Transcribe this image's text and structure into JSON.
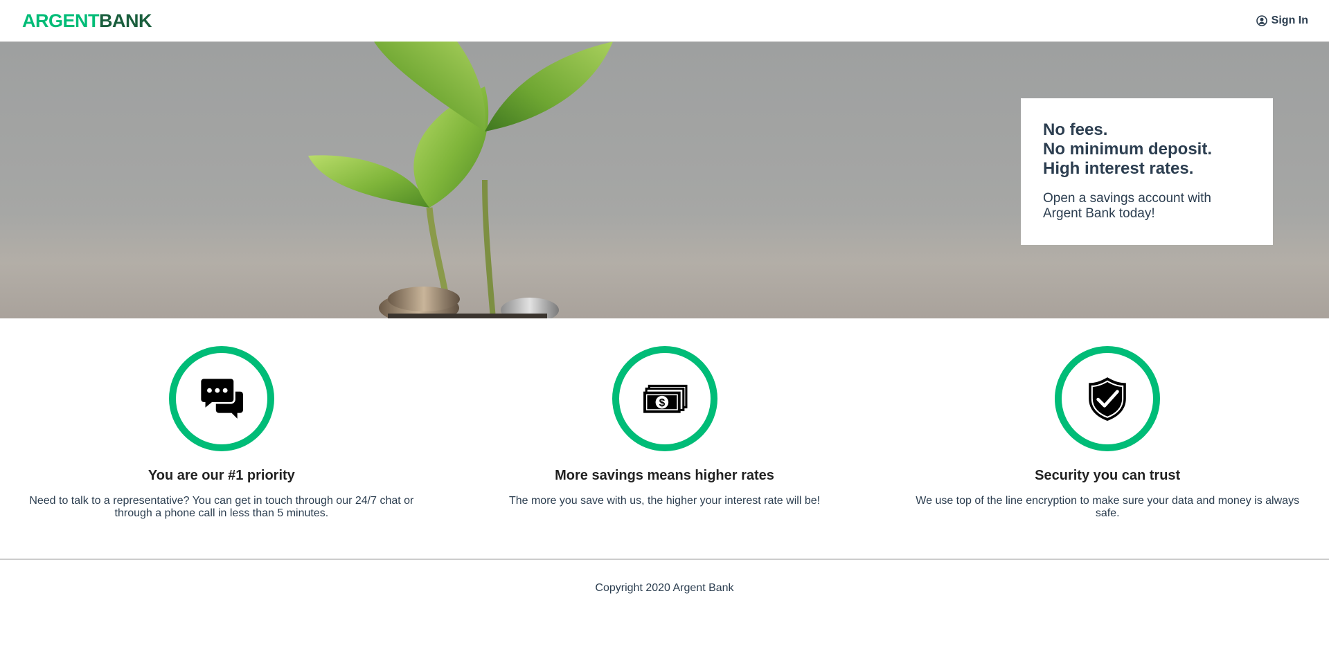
{
  "nav": {
    "logo_part1": "ARGENT",
    "logo_part2": "BANK",
    "signin_label": "Sign In",
    "signin_icon": "user-circle-icon"
  },
  "hero": {
    "lines": [
      "No fees.",
      "No minimum deposit.",
      "High interest rates."
    ],
    "text": "Open a savings account with Argent Bank today!"
  },
  "features": [
    {
      "icon": "chat-icon",
      "title": "You are our #1 priority",
      "text": "Need to talk to a representative? You can get in touch through our 24/7 chat or through a phone call in less than 5 minutes."
    },
    {
      "icon": "money-icon",
      "title": "More savings means higher rates",
      "text": "The more you save with us, the higher your interest rate will be!"
    },
    {
      "icon": "security-shield-icon",
      "title": "Security you can trust",
      "text": "We use top of the line encryption to make sure your data and money is always safe."
    }
  ],
  "footer": {
    "text": "Copyright 2020 Argent Bank"
  },
  "colors": {
    "accent": "#00bc77",
    "brand_dark": "#1a5e3d",
    "text": "#2c3e50"
  }
}
